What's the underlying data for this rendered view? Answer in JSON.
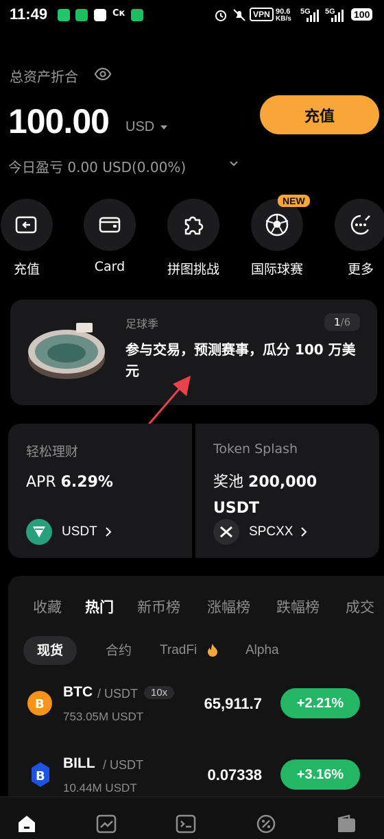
{
  "status_bar": {
    "time": "11:49",
    "vpn": "VPN",
    "speed_value": "90.6",
    "speed_unit": "KB/s",
    "net1": "5G",
    "net2": "5G",
    "battery": "100"
  },
  "assets": {
    "label": "总资产折合",
    "balance": "100.00",
    "currency": "USD",
    "recharge_button": "充值",
    "pnl": "今日盈亏 0.00 USD(0.00%)"
  },
  "quick_actions": [
    {
      "label": "充值",
      "icon": "deposit-icon"
    },
    {
      "label": "Card",
      "icon": "card-wallet-icon"
    },
    {
      "label": "拼图挑战",
      "icon": "puzzle-icon"
    },
    {
      "label": "国际球赛",
      "icon": "football-icon",
      "badge": "NEW"
    },
    {
      "label": "更多",
      "icon": "more-icon"
    }
  ],
  "banner": {
    "tag": "足球季",
    "title": "参与交易，预测赛事，瓜分 100 万美元",
    "page_current": "1",
    "page_total": "/6"
  },
  "cards": {
    "earn": {
      "title": "轻松理财",
      "apr_label": "APR",
      "apr_value": "6.29%",
      "coin": "USDT"
    },
    "splash": {
      "title": "Token Splash",
      "pool_label": "奖池",
      "pool_value": "200,000",
      "pool_unit": "USDT",
      "coin": "SPCXX"
    }
  },
  "market": {
    "tabs": [
      "收藏",
      "热门",
      "新币榜",
      "涨幅榜",
      "跌幅榜",
      "成交"
    ],
    "active_tab": "热门",
    "subtabs": [
      "现货",
      "合约",
      "TradFi",
      "Alpha"
    ],
    "active_subtab": "现货",
    "rows": [
      {
        "symbol": "BTC",
        "quote": "/ USDT",
        "leverage": "10x",
        "volume": "753.05M USDT",
        "price": "65,911.7",
        "change": "+2.21%"
      },
      {
        "symbol": "BILL",
        "quote": "/ USDT",
        "volume": "10.44M USDT",
        "price": "0.07338",
        "change": "+3.16%"
      }
    ]
  },
  "colors": {
    "accent": "#f7a738",
    "up": "#21b765",
    "card_bg": "#19191b"
  },
  "bottom_nav": [
    "home-icon",
    "market-icon",
    "trade-icon",
    "futures-icon",
    "wallet-icon"
  ]
}
